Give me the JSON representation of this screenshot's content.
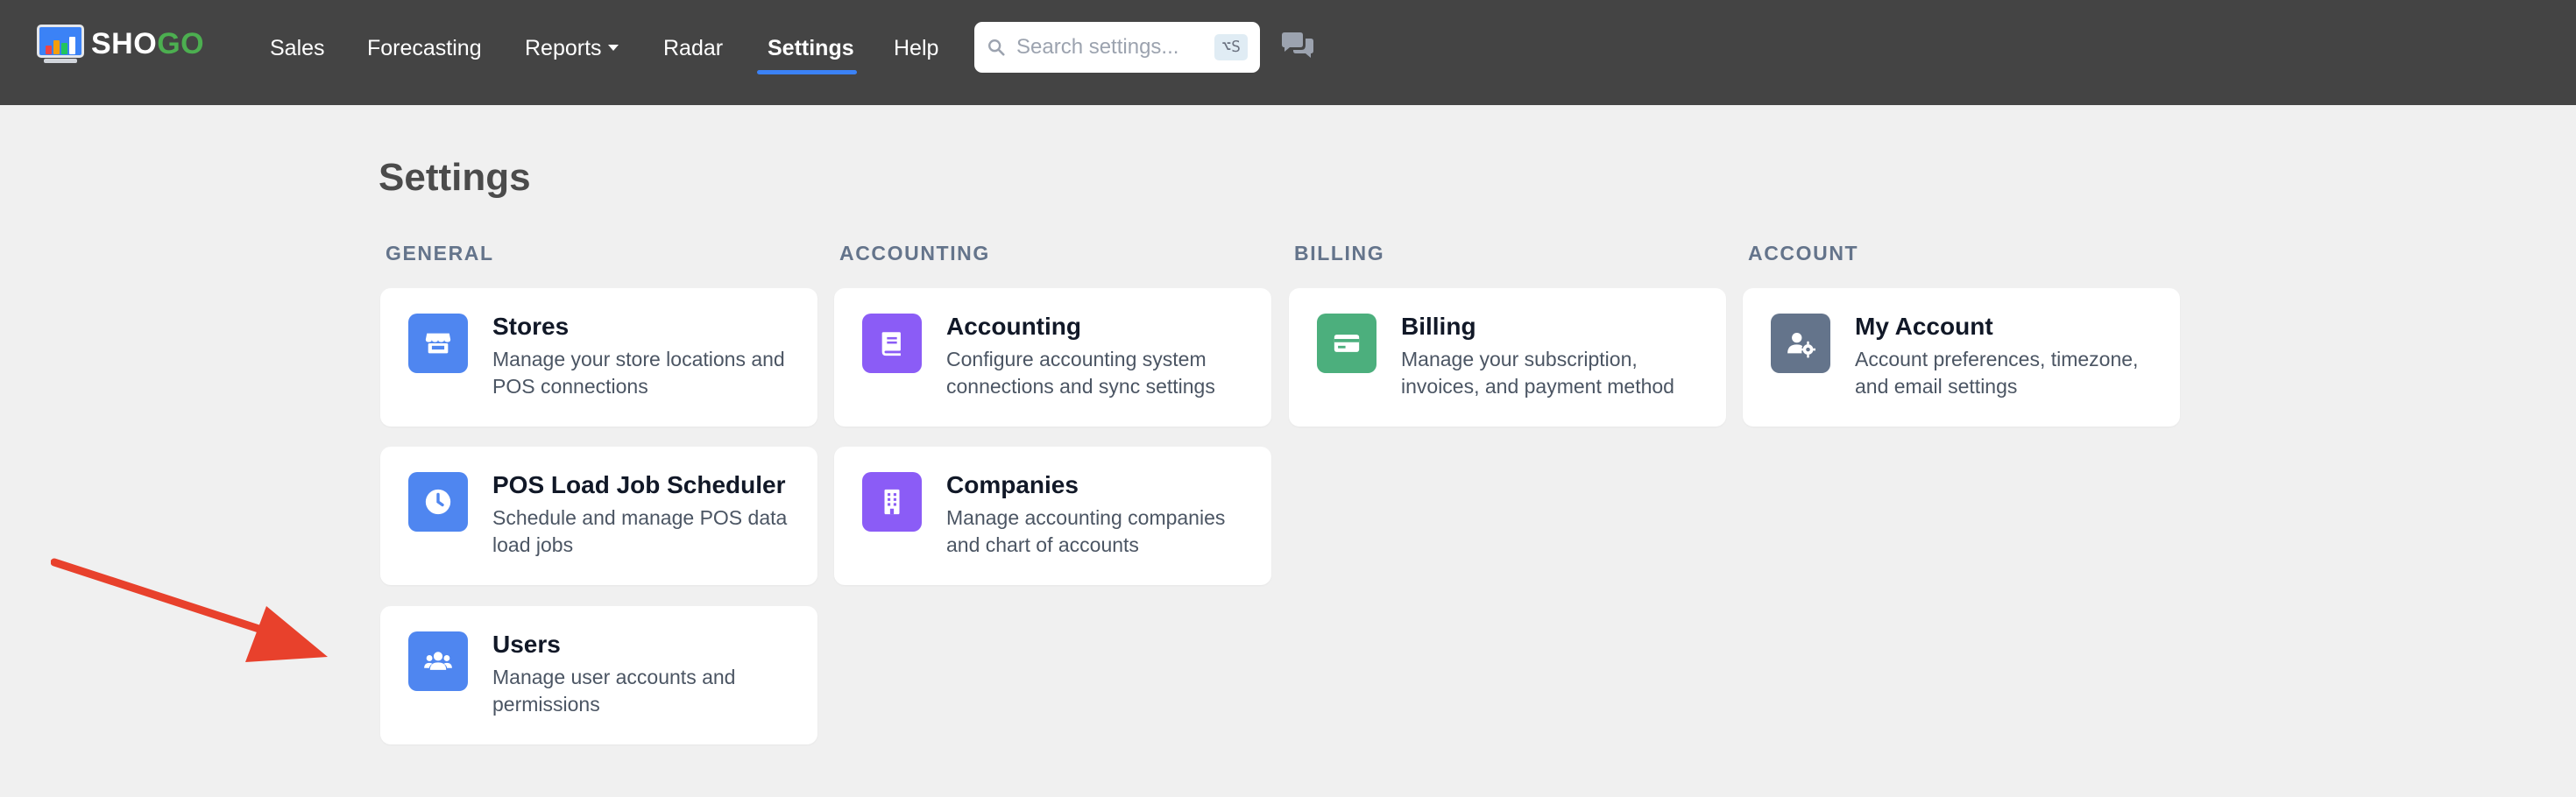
{
  "brand": {
    "name_part1": "SHO",
    "name_part2": "GO",
    "bar_colors": [
      "#ef4444",
      "#f59e0b",
      "#22c55e",
      "#ffffff"
    ]
  },
  "nav": {
    "items": [
      {
        "label": "Sales",
        "active": false
      },
      {
        "label": "Forecasting",
        "active": false
      },
      {
        "label": "Reports",
        "active": false,
        "has_dropdown": true
      },
      {
        "label": "Radar",
        "active": false
      },
      {
        "label": "Settings",
        "active": true
      },
      {
        "label": "Help",
        "active": false
      }
    ],
    "active_color": "#3b82f6",
    "search": {
      "placeholder": "Search settings...",
      "value": "",
      "shortcut": "⌥S",
      "icon": "search-icon"
    },
    "chat_icon": "chat-bubbles-icon"
  },
  "page": {
    "title": "Settings",
    "sections": [
      {
        "label": "GENERAL",
        "cards": [
          {
            "title": "Stores",
            "description": "Manage your store locations and POS connections",
            "icon": "store-icon",
            "color": "#4f86f0"
          },
          {
            "title": "POS Load Job Scheduler",
            "description": "Schedule and manage POS data load jobs",
            "icon": "clock-icon",
            "color": "#4f86f0"
          },
          {
            "title": "Users",
            "description": "Manage user accounts and permissions",
            "icon": "users-icon",
            "color": "#4f86f0"
          }
        ]
      },
      {
        "label": "ACCOUNTING",
        "cards": [
          {
            "title": "Accounting",
            "description": "Configure accounting system connections and sync settings",
            "icon": "book-icon",
            "color": "#8b5cf6"
          },
          {
            "title": "Companies",
            "description": "Manage accounting companies and chart of accounts",
            "icon": "building-icon",
            "color": "#8b5cf6"
          }
        ]
      },
      {
        "label": "BILLING",
        "cards": [
          {
            "title": "Billing",
            "description": "Manage your subscription, invoices, and payment method",
            "icon": "credit-card-icon",
            "color": "#4caf7d"
          }
        ]
      },
      {
        "label": "ACCOUNT",
        "cards": [
          {
            "title": "My Account",
            "description": "Account preferences, timezone, and email settings",
            "icon": "user-gear-icon",
            "color": "#64748b"
          }
        ]
      }
    ]
  },
  "annotation": {
    "icon": "red-arrow-icon",
    "color": "#e8412c"
  }
}
